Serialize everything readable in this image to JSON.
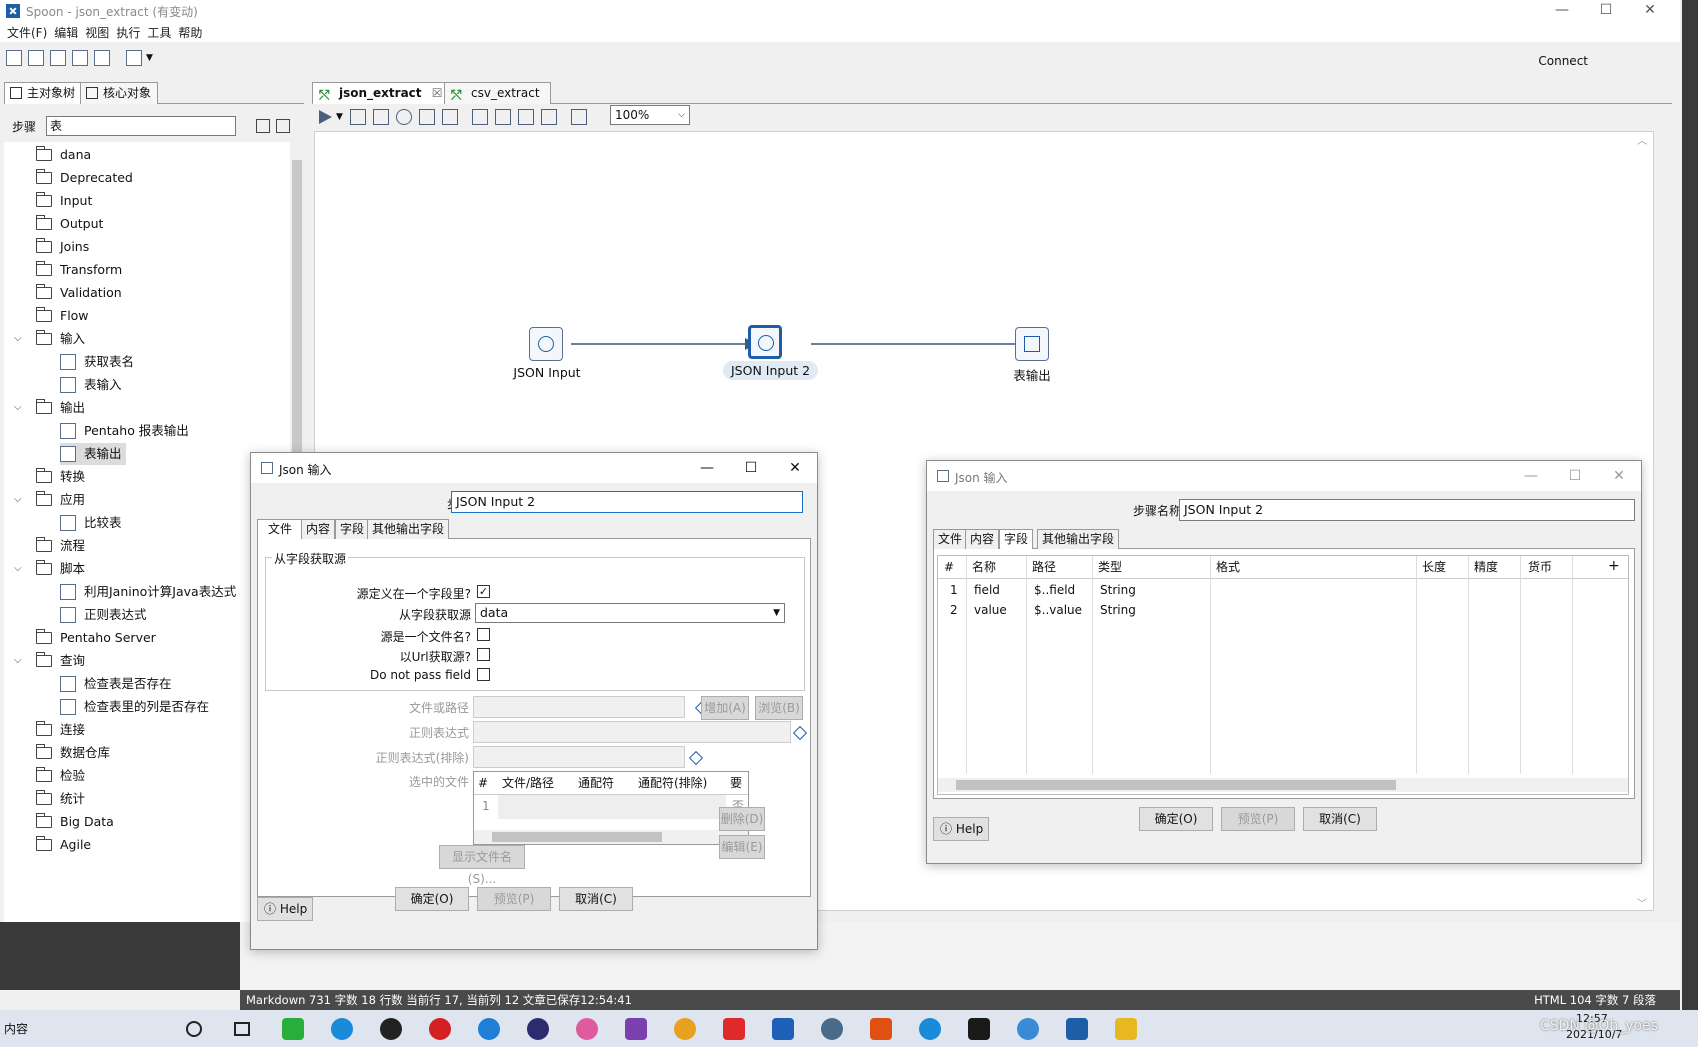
{
  "window": {
    "title": "Spoon - json_extract (有变动)",
    "minimize": "—",
    "maximize": "☐",
    "close": "✕"
  },
  "menu": [
    "文件(F)",
    "编辑",
    "视图",
    "执行",
    "工具",
    "帮助"
  ],
  "toolbar": {
    "connect": "Connect"
  },
  "left_tabs": [
    "主对象树",
    "核心对象"
  ],
  "steps": {
    "label": "步骤",
    "filter": "表"
  },
  "tree": [
    {
      "label": "dana",
      "type": "folder",
      "level": 0
    },
    {
      "label": "Deprecated",
      "type": "folder",
      "level": 0
    },
    {
      "label": "Input",
      "type": "folder",
      "level": 0
    },
    {
      "label": "Output",
      "type": "folder",
      "level": 0
    },
    {
      "label": "Joins",
      "type": "folder",
      "level": 0
    },
    {
      "label": "Transform",
      "type": "folder",
      "level": 0
    },
    {
      "label": "Validation",
      "type": "folder",
      "level": 0
    },
    {
      "label": "Flow",
      "type": "folder",
      "level": 0
    },
    {
      "label": "输入",
      "type": "folder",
      "level": 0,
      "expanded": true
    },
    {
      "label": "获取表名",
      "type": "step",
      "level": 1
    },
    {
      "label": "表输入",
      "type": "step",
      "level": 1
    },
    {
      "label": "输出",
      "type": "folder",
      "level": 0,
      "expanded": true
    },
    {
      "label": "Pentaho 报表输出",
      "type": "step",
      "level": 1
    },
    {
      "label": "表输出",
      "type": "step",
      "level": 1,
      "selected": true
    },
    {
      "label": "转换",
      "type": "folder",
      "level": 0
    },
    {
      "label": "应用",
      "type": "folder",
      "level": 0,
      "expanded": true
    },
    {
      "label": "比较表",
      "type": "step",
      "level": 1
    },
    {
      "label": "流程",
      "type": "folder",
      "level": 0
    },
    {
      "label": "脚本",
      "type": "folder",
      "level": 0,
      "expanded": true
    },
    {
      "label": "利用Janino计算Java表达式",
      "type": "step",
      "level": 1
    },
    {
      "label": "正则表达式",
      "type": "step",
      "level": 1
    },
    {
      "label": "Pentaho Server",
      "type": "folder",
      "level": 0
    },
    {
      "label": "查询",
      "type": "folder",
      "level": 0,
      "expanded": true
    },
    {
      "label": "检查表是否存在",
      "type": "step",
      "level": 1
    },
    {
      "label": "检查表里的列是否存在",
      "type": "step",
      "level": 1
    },
    {
      "label": "连接",
      "type": "folder",
      "level": 0
    },
    {
      "label": "数据仓库",
      "type": "folder",
      "level": 0
    },
    {
      "label": "检验",
      "type": "folder",
      "level": 0
    },
    {
      "label": "统计",
      "type": "folder",
      "level": 0
    },
    {
      "label": "Big Data",
      "type": "folder",
      "level": 0
    },
    {
      "label": "Agile",
      "type": "folder",
      "level": 0
    }
  ],
  "editor_tabs": [
    {
      "label": "json_extract",
      "active": true,
      "close": "☒"
    },
    {
      "label": "csv_extract",
      "active": false
    }
  ],
  "zoom": "100%",
  "canvas_nodes": [
    {
      "label": "JSON Input",
      "selected": false
    },
    {
      "label": "JSON Input 2",
      "selected": true
    },
    {
      "label": "表输出",
      "selected": false
    }
  ],
  "dialog1": {
    "title": "Json 输入",
    "step_name_label": "步骤名称",
    "step_name": "JSON Input 2",
    "tabs": [
      "文件",
      "内容",
      "字段",
      "其他输出字段"
    ],
    "group": "从字段获取源",
    "rows": [
      {
        "label": "源定义在一个字段里?",
        "checked": true
      },
      {
        "label": "从字段获取源",
        "value": "data"
      },
      {
        "label": "源是一个文件名?",
        "checked": false
      },
      {
        "label": "以Url获取源?",
        "checked": false
      },
      {
        "label": "Do not pass field",
        "checked": false
      }
    ],
    "file_label": "文件或路径",
    "regex_label": "正则表达式",
    "regex_excl_label": "正则表达式(排除)",
    "selected_files_label": "选中的文件",
    "add_btn": "增加(A)",
    "browse_btn": "浏览(B)",
    "delete_btn": "删除(D)",
    "edit_btn": "编辑(E)",
    "show_files_btn": "显示文件名(S)...",
    "file_grid": {
      "headers": [
        "#",
        "文件/路径",
        "通配符",
        "通配符(排除)",
        "要求"
      ],
      "rows": [
        [
          "1",
          "",
          "",
          "",
          "否"
        ]
      ]
    },
    "help": "Help",
    "ok": "确定(O)",
    "preview": "预览(P)",
    "cancel": "取消(C)"
  },
  "dialog2": {
    "title": "Json 输入",
    "step_name_label": "步骤名称",
    "step_name": "JSON Input 2",
    "tabs": [
      "文件",
      "内容",
      "字段",
      "其他输出字段"
    ],
    "grid": {
      "headers": [
        "#",
        "名称",
        "路径",
        "类型",
        "格式",
        "长度",
        "精度",
        "货币"
      ],
      "rows": [
        [
          "1",
          "field",
          "$..field",
          "String"
        ],
        [
          "2",
          "value",
          "$..value",
          "String"
        ]
      ]
    },
    "help": "Help",
    "ok": "确定(O)",
    "preview": "预览(P)",
    "cancel": "取消(C)"
  },
  "statusbar": {
    "left": "Markdown   731 字数   18 行数   当前行 17, 当前列 12   文章已保存12:54:41",
    "right": "HTML   104 字数   7 段落"
  },
  "taskbar": {
    "search": "内容",
    "time": "12:57",
    "date": "2021/10/7",
    "watermark": "CSDN @Oh_yoes"
  }
}
